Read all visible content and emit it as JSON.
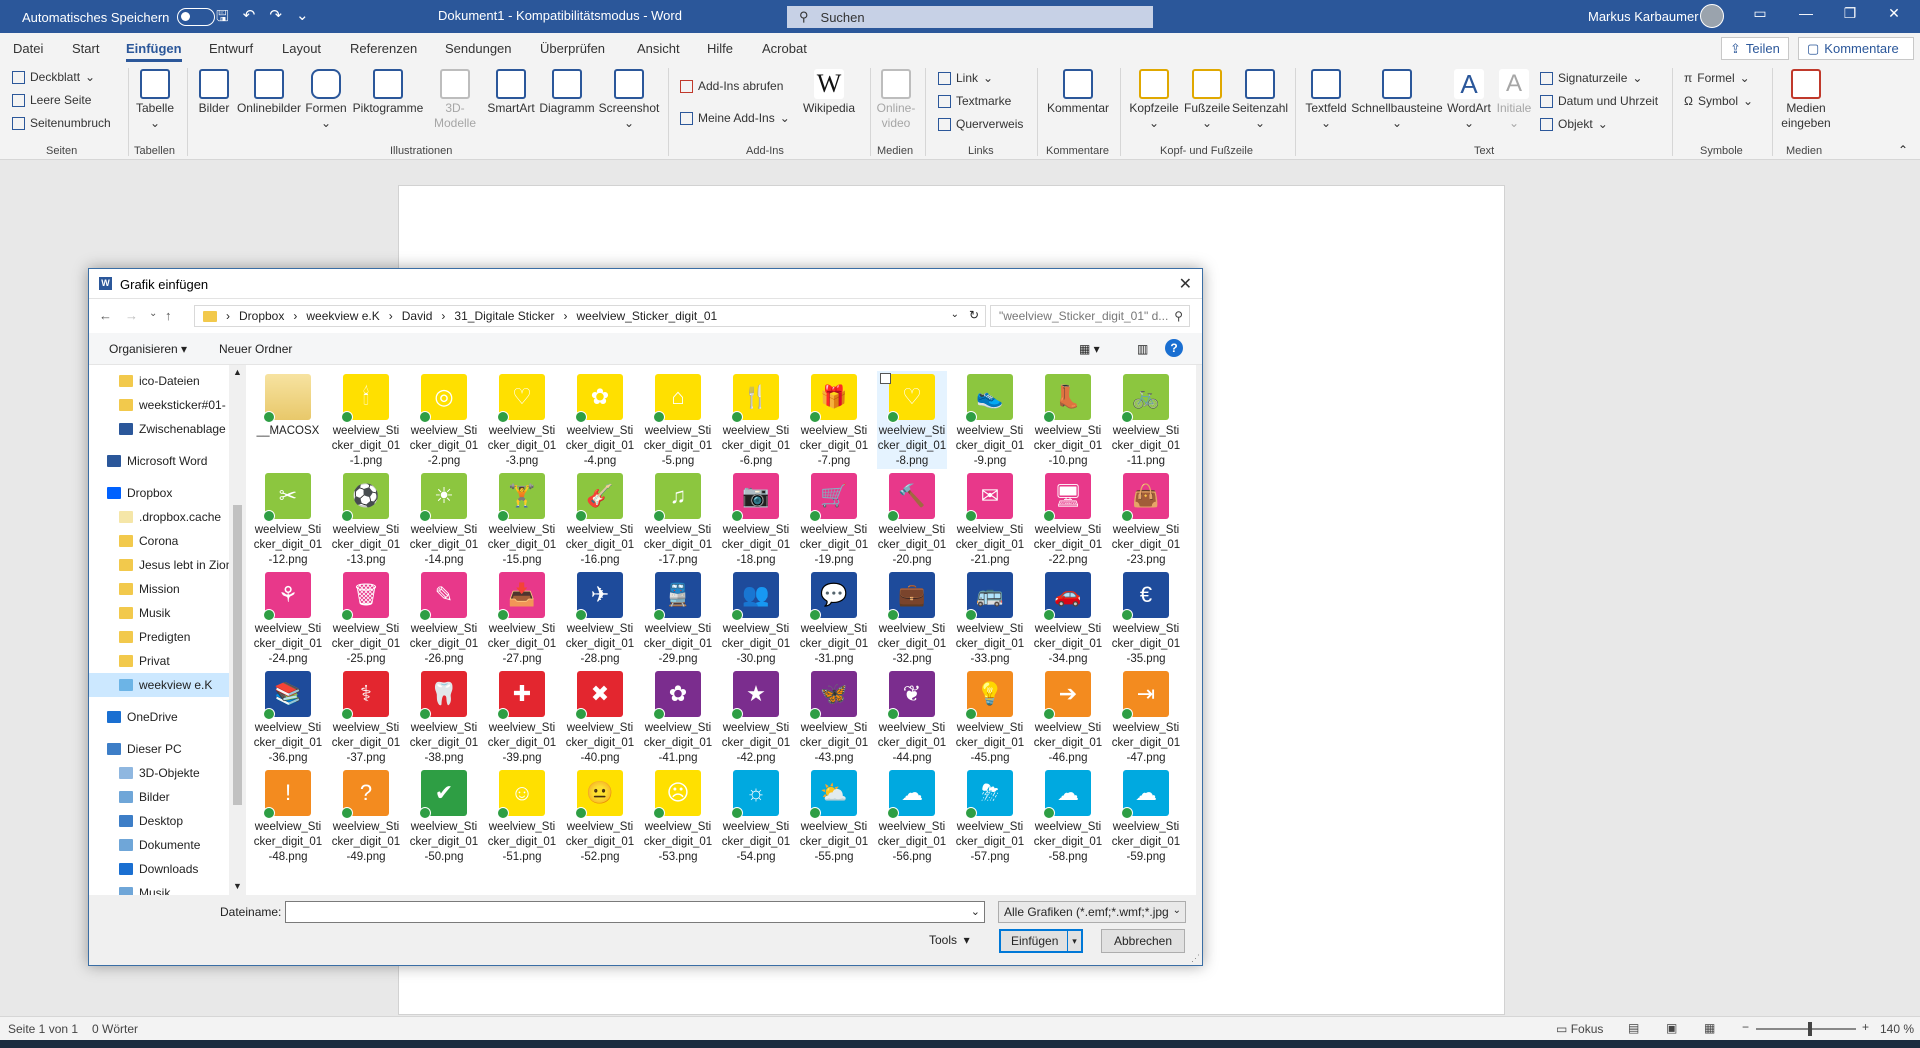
{
  "titlebar": {
    "autosave": "Automatisches Speichern",
    "title": "Dokument1  -  Kompatibilitätsmodus  -  Word",
    "search": "Suchen",
    "user": "Markus Karbaumer"
  },
  "menu": {
    "tabs": [
      "Datei",
      "Start",
      "Einfügen",
      "Entwurf",
      "Layout",
      "Referenzen",
      "Sendungen",
      "Überprüfen",
      "Ansicht",
      "Hilfe",
      "Acrobat"
    ],
    "active": "Einfügen",
    "share": "Teilen",
    "comments": "Kommentare"
  },
  "ribbon": {
    "seiten": [
      "Deckblatt",
      "Leere Seite",
      "Seitenumbruch"
    ],
    "tabelle": "Tabelle",
    "illus": [
      "Bilder",
      "Onlinebilder",
      "Formen",
      "Piktogramme",
      "3D-Modelle",
      "SmartArt",
      "Diagramm",
      "Screenshot"
    ],
    "addins": [
      "Add-Ins abrufen",
      "Meine Add-Ins"
    ],
    "wikipedia": "Wikipedia",
    "onlinevideo": "Online-video",
    "links": [
      "Link",
      "Textmarke",
      "Querverweis"
    ],
    "kommentar": "Kommentar",
    "kopf": [
      "Kopfzeile",
      "Fußzeile",
      "Seitenzahl"
    ],
    "text": [
      "Textfeld",
      "Schnellbausteine",
      "WordArt",
      "Initiale"
    ],
    "textsmall": [
      "Signaturzeile",
      "Datum und Uhrzeit",
      "Objekt"
    ],
    "symbole": [
      "Formel",
      "Symbol"
    ],
    "medien": "Medien eingeben",
    "groups": [
      "Seiten",
      "Tabellen",
      "Illustrationen",
      "Add-Ins",
      "Medien",
      "Links",
      "Kommentare",
      "Kopf- und Fußzeile",
      "Text",
      "Symbole",
      "Medien"
    ]
  },
  "dialog": {
    "title": "Grafik einfügen",
    "path": [
      "Dropbox",
      "weekview e.K",
      "David",
      "31_Digitale Sticker",
      "weelview_Sticker_digit_01"
    ],
    "search": "\"weelview_Sticker_digit_01\" d...",
    "organize": "Organisieren",
    "newfolder": "Neuer Ordner",
    "nav": [
      "ico-Dateien",
      "weeksticker#01-",
      "Zwischenablage",
      "Microsoft Word",
      "Dropbox",
      ".dropbox.cache",
      "Corona",
      "Jesus lebt in Zion",
      "Mission",
      "Musik",
      "Predigten",
      "Privat",
      "weekview e.K",
      "OneDrive",
      "Dieser PC",
      "3D-Objekte",
      "Bilder",
      "Desktop",
      "Dokumente",
      "Downloads",
      "Musik"
    ],
    "firstfile": "__MACOSX",
    "filePrefix": "weelview_Sticker_digit_01-",
    "fileExt": ".png",
    "selectedFile": "weelview_Sticker_digit_01-8.png",
    "colors": [
      "#ffe000",
      "#8cc63f",
      "#e8388a",
      "#1e4b9b",
      "#e3262f",
      "#7b2d8e",
      "#f38b1f",
      "#2e9e44",
      "#00a9e0"
    ],
    "filename_label": "Dateiname:",
    "filename_value": "",
    "filter": "Alle Grafiken (*.emf;*.wmf;*.jpg",
    "tools": "Tools",
    "insert": "Einfügen",
    "cancel": "Abbrechen"
  },
  "status": {
    "page": "Seite 1 von 1",
    "words": "0 Wörter",
    "focus": "Fokus",
    "zoom": "140 %"
  }
}
